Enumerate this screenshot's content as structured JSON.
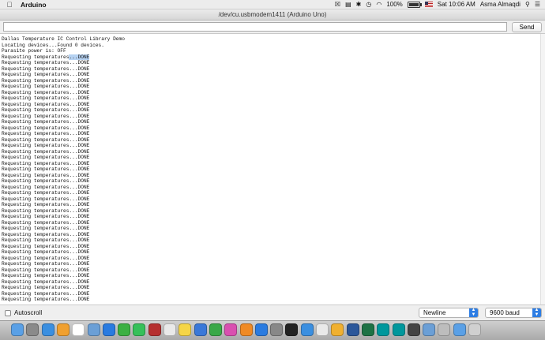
{
  "menubar": {
    "app_name": "Arduino",
    "battery_percent": "100%",
    "datetime": "Sat 10:06 AM",
    "user": "Asma Almaqdi",
    "battery_level": 1.0
  },
  "window": {
    "title": "/dev/cu.usbmodem1411 (Arduino Uno)"
  },
  "input": {
    "value": "",
    "send_label": "Send"
  },
  "output": {
    "lines": [
      "Dallas Temperature IC Control Library Demo",
      "Locating devices...Found 0 devices.",
      "Parasite power is: OFF",
      "Requesting temperatures...DONE",
      "Requesting temperatures...DONE",
      "Requesting temperatures...DONE",
      "Requesting temperatures...DONE",
      "Requesting temperatures...DONE",
      "Requesting temperatures...DONE",
      "Requesting temperatures...DONE",
      "Requesting temperatures...DONE",
      "Requesting temperatures...DONE",
      "Requesting temperatures...DONE",
      "Requesting temperatures...DONE",
      "Requesting temperatures...DONE",
      "Requesting temperatures...DONE",
      "Requesting temperatures...DONE",
      "Requesting temperatures...DONE",
      "Requesting temperatures...DONE",
      "Requesting temperatures...DONE",
      "Requesting temperatures...DONE",
      "Requesting temperatures...DONE",
      "Requesting temperatures...DONE",
      "Requesting temperatures...DONE",
      "Requesting temperatures...DONE",
      "Requesting temperatures...DONE",
      "Requesting temperatures...DONE",
      "Requesting temperatures...DONE",
      "Requesting temperatures...DONE",
      "Requesting temperatures...DONE",
      "Requesting temperatures...DONE",
      "Requesting temperatures...DONE",
      "Requesting temperatures...DONE",
      "Requesting temperatures...DONE",
      "Requesting temperatures...DONE",
      "Requesting temperatures...DONE",
      "Requesting temperatures...DONE",
      "Requesting temperatures...DONE",
      "Requesting temperatures...DONE",
      "Requesting temperatures...DONE",
      "Requesting temperatures...DONE",
      "Requesting temperatures...DONE",
      "Requesting temperatures...DONE",
      "Requesting temperatures...DONE",
      "Requesting temperatures...DONE"
    ],
    "highlighted_line_index": 3
  },
  "bottom": {
    "autoscroll_label": "Autoscroll",
    "autoscroll_checked": false,
    "line_ending": "Newline",
    "baud": "9600 baud"
  },
  "colors": {
    "selection": "#b6d2f2",
    "accent": "#2d7de3"
  },
  "dock": {
    "icons": [
      "finder-icon",
      "launchpad-icon",
      "safari-icon",
      "photos-icon",
      "calendar-icon",
      "preview-icon",
      "app-store-icon",
      "facetime-icon",
      "messages-icon",
      "photo-booth-icon",
      "chrome-icon",
      "notes-icon",
      "keynote-icon",
      "numbers-icon",
      "itunes-icon",
      "ibooks-icon",
      "appstore2-icon",
      "system-preferences-icon",
      "terminal-icon",
      "safari2-icon",
      "chrome2-icon",
      "sketch-icon",
      "word-icon",
      "excel-icon",
      "arduino-icon",
      "arduino2-icon",
      "other-icon",
      "preview2-icon",
      "downloads-icon",
      "folder-icon",
      "trash-icon"
    ]
  }
}
